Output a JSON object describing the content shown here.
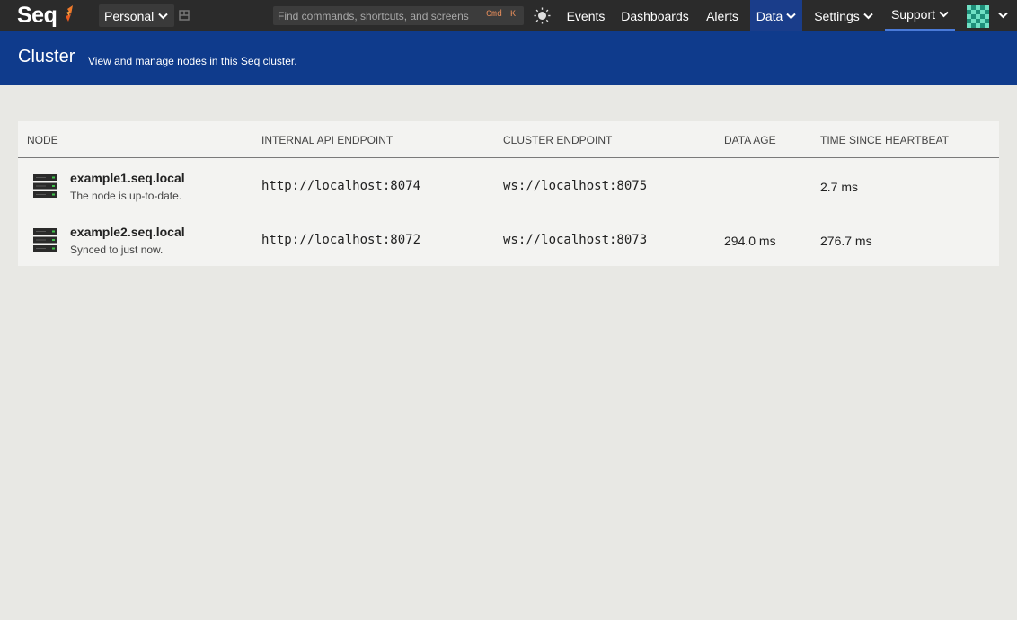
{
  "app": {
    "logo_text": "Seq",
    "workspace": "Personal",
    "search": {
      "placeholder": "Find commands, shortcuts, and screens",
      "shortcut_mod": "Cmd",
      "shortcut_key": "K"
    },
    "nav": {
      "events": "Events",
      "dashboards": "Dashboards",
      "alerts": "Alerts",
      "data": "Data",
      "settings": "Settings",
      "support": "Support"
    },
    "colors": {
      "topbar": "#2b2b2b",
      "header": "#0f3b8c",
      "active_nav": "#1a3d8a",
      "underline": "#4a7ad8"
    }
  },
  "header": {
    "title": "Cluster",
    "subtitle": "View and manage nodes in this Seq cluster."
  },
  "table": {
    "columns": {
      "node": "NODE",
      "internal_api": "INTERNAL API ENDPOINT",
      "cluster_endpoint": "CLUSTER ENDPOINT",
      "data_age": "DATA AGE",
      "heartbeat": "TIME SINCE HEARTBEAT"
    },
    "rows": [
      {
        "name": "example1.seq.local",
        "status": "The node is up-to-date.",
        "internal_api": "http://localhost:8074",
        "cluster_endpoint": "ws://localhost:8075",
        "data_age": "",
        "heartbeat": "2.7 ms"
      },
      {
        "name": "example2.seq.local",
        "status": "Synced to just now.",
        "internal_api": "http://localhost:8072",
        "cluster_endpoint": "ws://localhost:8073",
        "data_age": "294.0 ms",
        "heartbeat": "276.7 ms"
      }
    ]
  },
  "icons": [
    "seq-logo-icon",
    "chevron-down-icon",
    "pin-icon",
    "theme-toggle-icon",
    "user-avatar-icon",
    "server-icon"
  ]
}
